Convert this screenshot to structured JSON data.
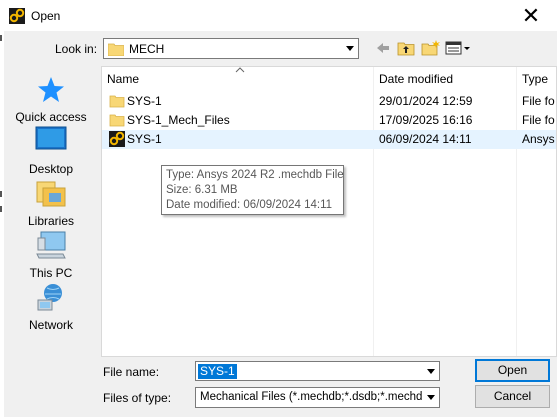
{
  "window": {
    "title": "Open",
    "close_glyph": "✕"
  },
  "look_in": {
    "label": "Look in:",
    "value": "MECH"
  },
  "places": [
    {
      "label": "Quick access",
      "icon": "quick-access-icon"
    },
    {
      "label": "Desktop",
      "icon": "desktop-icon"
    },
    {
      "label": "Libraries",
      "icon": "libraries-icon"
    },
    {
      "label": "This PC",
      "icon": "this-pc-icon"
    },
    {
      "label": "Network",
      "icon": "network-icon"
    }
  ],
  "columns": {
    "name": "Name",
    "date": "Date modified",
    "type": "Type"
  },
  "files": [
    {
      "name": "SYS-1",
      "date": "29/01/2024 12:59",
      "type": "File fo",
      "icon": "folder-icon"
    },
    {
      "name": "SYS-1_Mech_Files",
      "date": "17/09/2025 16:16",
      "type": "File fo",
      "icon": "folder-icon"
    },
    {
      "name": "SYS-1",
      "date": "06/09/2024 14:11",
      "type": "Ansys",
      "icon": "ansys-mechdb-icon",
      "selected": true
    }
  ],
  "tooltip": {
    "type_line": "Type: Ansys 2024 R2 .mechdb File",
    "size_line": "Size: 6.31 MB",
    "date_line": "Date modified: 06/09/2024 14:11"
  },
  "file_name": {
    "label": "File name:",
    "value": "SYS-1"
  },
  "files_of_type": {
    "label": "Files of type:",
    "value": "Mechanical Files (*.mechdb;*.dsdb;*.mechdat;*"
  },
  "buttons": {
    "open": "Open",
    "cancel": "Cancel"
  },
  "colors": {
    "selection": "#0078d7",
    "row_highlight": "#e5f3ff",
    "folder": "#f8d775"
  }
}
